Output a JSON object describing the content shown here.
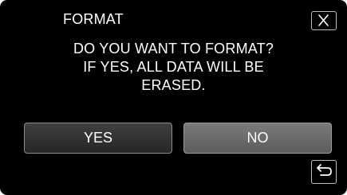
{
  "dialog": {
    "title": "FORMAT",
    "message_lines": [
      "DO YOU WANT TO FORMAT?",
      "IF YES, ALL DATA WILL BE",
      "ERASED."
    ]
  },
  "buttons": {
    "yes_label": "YES",
    "no_label": "NO",
    "close_icon": "close-icon",
    "back_icon": "return-arrow-icon"
  },
  "colors": {
    "background": "#000000",
    "text": "#ffffff",
    "yes_button": "#333333",
    "no_button": "#6a6a6a",
    "border": "#bdbdbd"
  }
}
